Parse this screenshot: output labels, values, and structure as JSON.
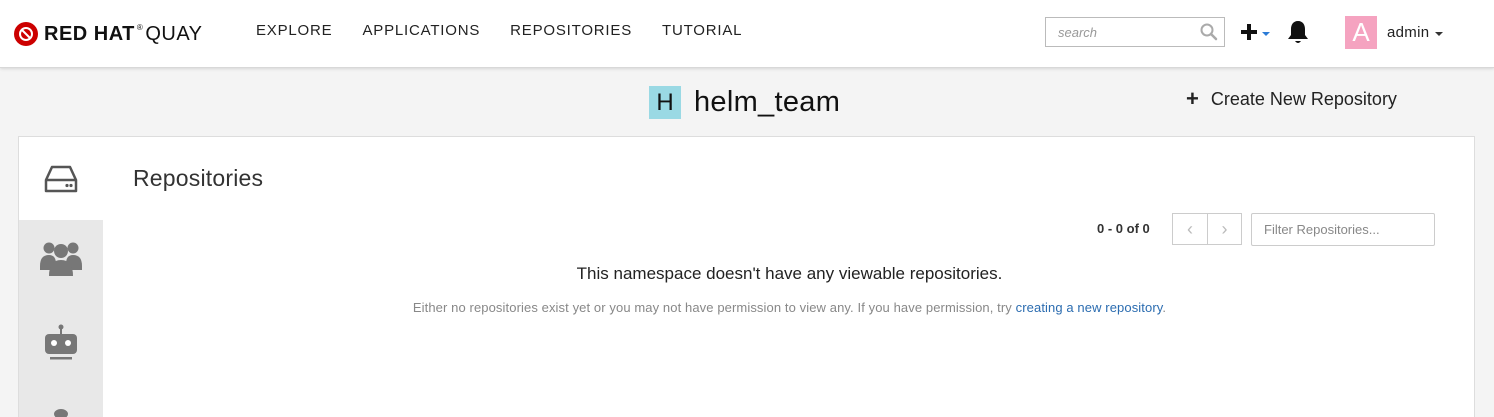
{
  "navbar": {
    "brand": {
      "name_bold": "RED HAT",
      "registered": "®",
      "product": "QUAY",
      "icon": "redhat-logo-icon",
      "color": "#cc0000"
    },
    "links": [
      "EXPLORE",
      "APPLICATIONS",
      "REPOSITORIES",
      "TUTORIAL"
    ],
    "search": {
      "placeholder": "search",
      "icon": "search-icon"
    },
    "create_icon": "plus-icon",
    "notifications_icon": "bell-icon",
    "user": {
      "avatar_letter": "A",
      "name": "admin",
      "avatar_color": "#f5a3c0"
    }
  },
  "header": {
    "org_avatar_letter": "H",
    "org_avatar_color": "#9ad9e4",
    "org_name": "helm_team",
    "create_repo_label": "Create New Repository"
  },
  "sidebar": {
    "tabs": [
      {
        "name": "repositories",
        "icon": "hdd-icon",
        "active": true
      },
      {
        "name": "teams",
        "icon": "users-icon",
        "active": false
      },
      {
        "name": "robots",
        "icon": "robot-icon",
        "active": false
      },
      {
        "name": "more",
        "icon": "partial-icon",
        "active": false
      }
    ]
  },
  "main": {
    "title": "Repositories",
    "pager": {
      "count_text": "0 - 0 of 0",
      "prev": "‹",
      "next": "›"
    },
    "filter_placeholder": "Filter Repositories...",
    "empty": {
      "title": "This namespace doesn't have any viewable repositories.",
      "desc_prefix": "Either no repositories exist yet or you may not have permission to view any. If you have permission, try ",
      "desc_link": "creating a new repository",
      "desc_suffix": "."
    }
  }
}
